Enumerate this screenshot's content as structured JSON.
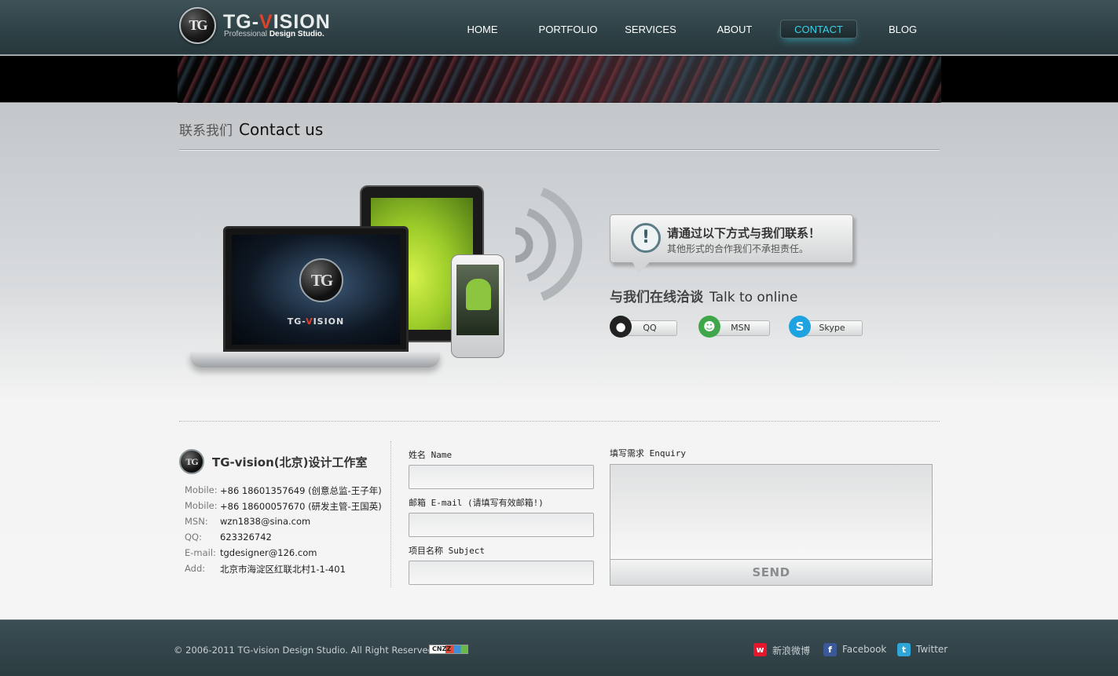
{
  "brand": {
    "name_prefix": "TG-",
    "name_v": "V",
    "name_suffix": "ISION",
    "tag_plain": "Professional",
    "tag_bold": "Design Studio.",
    "logo_mark": "TG"
  },
  "nav": {
    "items": [
      {
        "label": "HOME",
        "active": false
      },
      {
        "label": "PORTFOLIO",
        "active": false
      },
      {
        "label": "SERVICES",
        "active": false
      },
      {
        "label": "ABOUT",
        "active": false
      },
      {
        "label": "CONTACT",
        "active": true
      },
      {
        "label": "BLOG",
        "active": false
      }
    ],
    "active_color": "#37d3ea"
  },
  "page": {
    "title_cn": "联系我们",
    "title_en": "Contact us"
  },
  "devices": {
    "laptop_name_prefix": "TG-",
    "laptop_name_v": "V",
    "laptop_name_suffix": "ISION"
  },
  "notice": {
    "icon": "exclamation-icon",
    "title": "请通过以下方式与我们联系！",
    "subtitle": "其他形式的合作我们不承担责任。"
  },
  "talk": {
    "title_cn": "与我们在线洽谈",
    "title_en": "Talk to online",
    "buttons": [
      {
        "label": "QQ",
        "icon": "qq-penguin-icon"
      },
      {
        "label": "MSN",
        "icon": "msn-people-icon"
      },
      {
        "label": "Skype",
        "icon": "skype-icon"
      }
    ]
  },
  "studio": {
    "name": "TG-vision(北京)设计工作室",
    "rows": [
      {
        "key": "Mobile:",
        "value": "+86 18601357649 (创意总监-王子年)"
      },
      {
        "key": "Mobile:",
        "value": "+86 18600057670 (研发主管-王国英)"
      },
      {
        "key": "MSN:",
        "value": "wzn1838@sina.com"
      },
      {
        "key": "QQ:",
        "value": "623326742"
      },
      {
        "key": "E-mail:",
        "value": "tgdesigner@126.com"
      },
      {
        "key": "Add:",
        "value": "北京市海淀区红联北村1-1-401"
      }
    ]
  },
  "form": {
    "name_label": "姓名 Name",
    "name_value": "",
    "email_label": "邮箱 E-mail (请填写有效邮箱!)",
    "email_value": "",
    "subject_label": "项目名称 Subject",
    "subject_value": "",
    "enquiry_label": "填写需求 Enquiry",
    "enquiry_value": "",
    "send_label": "SEND"
  },
  "footer": {
    "copyright": "© 2006-2011 TG-vision Design Studio. All Right Reserved.",
    "counter_badge": "CNZZ",
    "social": [
      {
        "label": "新浪微博",
        "icon": "weibo-icon",
        "color": "#e6162d"
      },
      {
        "label": "Facebook",
        "icon": "facebook-icon",
        "color": "#3b5998"
      },
      {
        "label": "Twitter",
        "icon": "twitter-icon",
        "color": "#2fa6d8"
      }
    ]
  }
}
